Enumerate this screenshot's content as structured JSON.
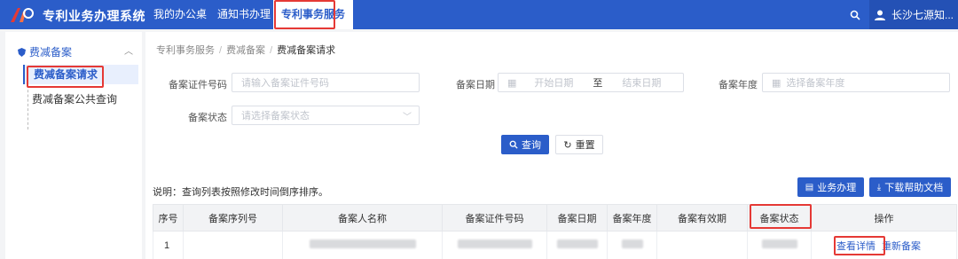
{
  "app": {
    "title": "专利业务办理系统",
    "nav": [
      "我的办公桌",
      "通知书办理",
      "专利事务服务"
    ],
    "user_name": "长沙七源知..."
  },
  "sidebar": {
    "group": "费减备案",
    "items": [
      "费减备案请求",
      "费减备案公共查询"
    ]
  },
  "breadcrumb": [
    "专利事务服务",
    "费减备案",
    "费减备案请求"
  ],
  "form": {
    "cert_label": "备案证件号码",
    "cert_placeholder": "请输入备案证件号码",
    "date_label": "备案日期",
    "date_start": "开始日期",
    "date_to": "至",
    "date_end": "结束日期",
    "year_label": "备案年度",
    "year_placeholder": "选择备案年度",
    "status_label": "备案状态",
    "status_placeholder": "请选择备案状态",
    "query_button": "查询",
    "reset_button": "重置"
  },
  "note": "说明：查询列表按照修改时间倒序排序。",
  "actions": {
    "business_button": "业务办理",
    "download_button": "下载帮助文档"
  },
  "table": {
    "headers": [
      "序号",
      "备案序列号",
      "备案人名称",
      "备案证件号码",
      "备案日期",
      "备案年度",
      "备案有效期",
      "备案状态",
      "操作"
    ],
    "rows": [
      {
        "index": "1",
        "view_link": "查看详情",
        "refile_link": "重新备案"
      }
    ]
  },
  "colors": {
    "primary": "#2b5dc9",
    "highlight": "#e53935"
  }
}
